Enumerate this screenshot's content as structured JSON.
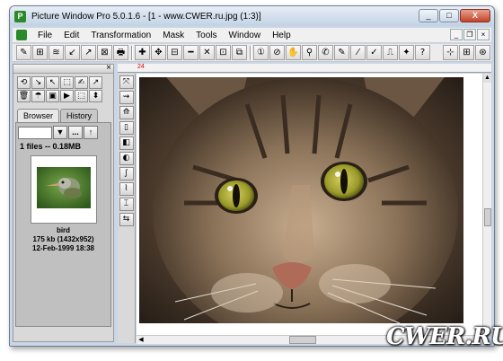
{
  "window": {
    "title": "Picture Window Pro 5.0.1.6 - [1 - www.CWER.ru.jpg (1:3)]",
    "app_icon": "P",
    "min_label": "_",
    "max_label": "□",
    "close_label": "X"
  },
  "menu": {
    "items": [
      "File",
      "Edit",
      "Transformation",
      "Mask",
      "Tools",
      "Window",
      "Help"
    ],
    "mdi_min": "_",
    "mdi_restore": "❐",
    "mdi_close": "×"
  },
  "toolbar": {
    "icons": [
      "✎",
      "⊞",
      "≋",
      "↙",
      "↗",
      "⊠",
      "🖶",
      "✚",
      "✥",
      "⊟",
      "━",
      "✕",
      "⊡",
      "⧉",
      "①",
      "⊘",
      "✋",
      "⚲",
      "✆",
      "✎",
      "⁄",
      "✓",
      "⎍",
      "✦",
      "?"
    ],
    "right_icons": [
      "⊹",
      "⊞",
      "⊛"
    ]
  },
  "left_panel": {
    "close": "×",
    "tool_icons": [
      "⟲",
      "↘",
      "↖",
      "⬚",
      "✍",
      "↗",
      "🗑",
      "☂",
      "▣",
      "▶",
      "⬚",
      "⬍"
    ],
    "tabs": [
      "Browser",
      "History"
    ],
    "nav_down": "▼",
    "nav_more": "...",
    "nav_up": "↑",
    "files_info": "1 files -- 0.18MB",
    "thumb": {
      "name": "bird",
      "size": "175 kb (1432x952)",
      "date": "12-Feb-1999 18:38"
    }
  },
  "ruler": {
    "mark": "24"
  },
  "side_tools": [
    "⤧",
    "⇝",
    "⟰",
    "▯",
    "◧",
    "◐",
    "∫",
    "⌇",
    "⌶",
    "⇆"
  ],
  "watermark": "CWER.RU"
}
